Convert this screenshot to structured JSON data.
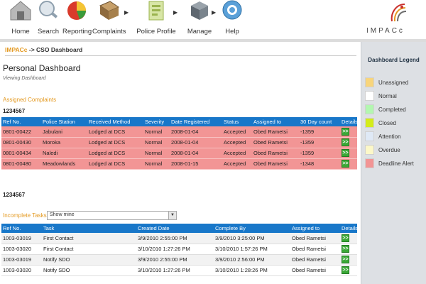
{
  "nav": {
    "items": [
      {
        "label": "Home",
        "icon": "home-icon"
      },
      {
        "label": "Search",
        "icon": "search-icon"
      },
      {
        "label": "Reporting",
        "icon": "reporting-icon"
      },
      {
        "label": "Complaints",
        "icon": "complaints-icon"
      },
      {
        "label": "Police Profile",
        "icon": "police-profile-icon"
      },
      {
        "label": "Manage",
        "icon": "manage-icon"
      },
      {
        "label": "Help",
        "icon": "help-icon"
      }
    ],
    "brand": "IMPACc"
  },
  "breadcrumb": {
    "root": "IMPACc",
    "separator": "->",
    "current": "CSO Dashboard"
  },
  "page": {
    "title": "Personal Dashboard",
    "subtitle": "Viewing Dashboard"
  },
  "assigned": {
    "section_title": "Assigned Complaints",
    "group_label": "1234567",
    "columns": [
      "Ref No.",
      "Police Station",
      "Received Method",
      "Severity",
      "Date Registered",
      "Status",
      "Assigned to",
      "30 Day count",
      "Details"
    ],
    "rows": [
      {
        "ref": "0801-00422",
        "station": "Jabulani",
        "method": "Lodged at DCS",
        "severity": "Normal",
        "date": "2008-01-04",
        "status": "Accepted",
        "assigned": "Obed Rametsi",
        "count": "-1359"
      },
      {
        "ref": "0801-00430",
        "station": "Moroka",
        "method": "Lodged at DCS",
        "severity": "Normal",
        "date": "2008-01-04",
        "status": "Accepted",
        "assigned": "Obed Rametsi",
        "count": "-1359"
      },
      {
        "ref": "0801-00434",
        "station": "Naledi",
        "method": "Lodged at DCS",
        "severity": "Normal",
        "date": "2008-01-04",
        "status": "Accepted",
        "assigned": "Obed Rametsi",
        "count": "-1359"
      },
      {
        "ref": "0801-00480",
        "station": "Meadowlands",
        "method": "Lodged at DCS",
        "severity": "Normal",
        "date": "2008-01-15",
        "status": "Accepted",
        "assigned": "Obed Rametsi",
        "count": "-1348"
      }
    ],
    "details_glyph": ">>"
  },
  "second_group_label": "1234567",
  "incomplete": {
    "section_title": "Incomplete Tasks",
    "filter_value": "Show mine",
    "columns": [
      "Ref No.",
      "Task",
      "Created Date",
      "Complete By",
      "Assigned to",
      "Details"
    ],
    "rows": [
      {
        "ref": "1003-03019",
        "task": "First Contact",
        "created": "3/9/2010 2:55:00 PM",
        "complete_by": "3/9/2010 3:25:00 PM",
        "assigned": "Obed Rametsi"
      },
      {
        "ref": "1003-03020",
        "task": "First Contact",
        "created": "3/10/2010 1:27:26 PM",
        "complete_by": "3/10/2010 1:57:26 PM",
        "assigned": "Obed Rametsi"
      },
      {
        "ref": "1003-03019",
        "task": "Notify SDO",
        "created": "3/9/2010 2:55:00 PM",
        "complete_by": "3/9/2010 2:56:00 PM",
        "assigned": "Obed Rametsi"
      },
      {
        "ref": "1003-03020",
        "task": "Notify SDO",
        "created": "3/10/2010 1:27:26 PM",
        "complete_by": "3/10/2010 1:28:26 PM",
        "assigned": "Obed Rametsi"
      }
    ],
    "details_glyph": ">>"
  },
  "legend": {
    "title": "Dashboard Legend",
    "items": [
      {
        "label": "Unassigned",
        "color": "#f8d57c"
      },
      {
        "label": "Normal",
        "color": "#ffffff"
      },
      {
        "label": "Completed",
        "color": "#b3f7b0"
      },
      {
        "label": "Closed",
        "color": "#d4ec1a"
      },
      {
        "label": "Attention",
        "color": "#dfe9f6"
      },
      {
        "label": "Overdue",
        "color": "#fcf8c8"
      },
      {
        "label": "Deadline Alert",
        "color": "#f29595"
      }
    ]
  },
  "colors": {
    "accent": "#e49a22",
    "header_blue": "#1877c9",
    "alert_row": "#f29595",
    "details_green": "#3aa836"
  }
}
